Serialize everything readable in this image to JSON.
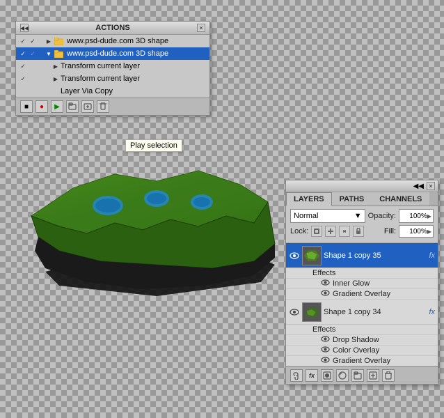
{
  "actions_panel": {
    "title": "ACTIONS",
    "scroll_left": "◀◀",
    "close": "✕",
    "rows": [
      {
        "id": "row1",
        "checked": true,
        "checked2": true,
        "indent": false,
        "triangle": null,
        "icon": "folder",
        "text": "www.psd-dude.com 3D shape",
        "selected": false
      },
      {
        "id": "row2",
        "checked": true,
        "checked2": false,
        "indent": false,
        "triangle": "▼",
        "icon": "folder",
        "text": "www.psd-dude.com 3D shape",
        "selected": true
      },
      {
        "id": "row3",
        "checked": true,
        "checked2": false,
        "indent": true,
        "triangle": "▶",
        "icon": null,
        "text": "Transform current layer",
        "selected": false
      },
      {
        "id": "row4",
        "checked": true,
        "checked2": false,
        "indent": true,
        "triangle": "▶",
        "icon": null,
        "text": "Transform current layer",
        "selected": false
      },
      {
        "id": "row5",
        "checked": false,
        "checked2": false,
        "indent": true,
        "triangle": null,
        "icon": null,
        "text": "Layer Via Copy",
        "selected": false
      }
    ],
    "toolbar_buttons": [
      "■",
      "●",
      "▶",
      "□□",
      "◫",
      "🗑"
    ]
  },
  "play_tooltip": "Play selection",
  "layers_panel": {
    "tabs": [
      {
        "id": "layers",
        "label": "LAYERS",
        "active": true
      },
      {
        "id": "paths",
        "label": "PATHS",
        "active": false
      },
      {
        "id": "channels",
        "label": "CHANNELS",
        "active": false
      }
    ],
    "blend_mode": "Normal",
    "blend_arrow": "▼",
    "opacity_label": "Opacity:",
    "opacity_value": "100%",
    "opacity_arrow": "▶",
    "lock_label": "Lock:",
    "fill_label": "Fill:",
    "fill_value": "100%",
    "fill_arrow": "▶",
    "lock_icons": [
      "□",
      "✛",
      "↔",
      "🔒"
    ],
    "layers": [
      {
        "id": "layer1",
        "eye": true,
        "name": "Shape 1 copy 35",
        "fx": "fx",
        "selected": true,
        "effects_label": "Effects",
        "effects": [
          {
            "name": "Inner Glow",
            "eye": true
          },
          {
            "name": "Gradient Overlay",
            "eye": true
          }
        ]
      },
      {
        "id": "layer2",
        "eye": true,
        "name": "Shape 1 copy 34",
        "fx": "fx",
        "selected": false,
        "effects_label": "Effects",
        "effects": [
          {
            "name": "Drop Shadow",
            "eye": true
          },
          {
            "name": "Color Overlay",
            "eye": true
          },
          {
            "name": "Gradient Overlay",
            "eye": true
          }
        ]
      }
    ],
    "toolbar_buttons": [
      "🔗",
      "fx",
      "◑",
      "🗑",
      "📁",
      "📄",
      "🗑"
    ]
  }
}
